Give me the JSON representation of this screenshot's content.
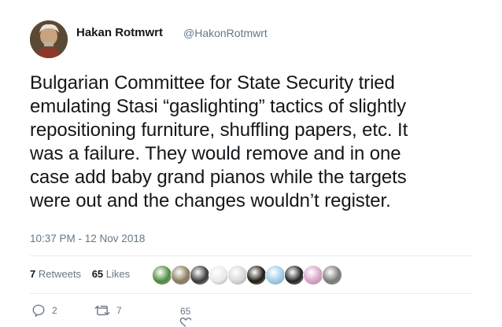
{
  "author": {
    "name": "Hakan Rotmwrt",
    "handle": "@HakonRotmwrt"
  },
  "tweet": {
    "lines": [
      "Bulgarian Committee for State Security tried",
      "emulating Stasi “gaslighting” tactics of slightly",
      "repositioning furniture, shuffling papers, etc. It",
      "was a failure. They would remove and in one",
      "case add baby grand pianos while the targets",
      "were out and the changes wouldn’t register."
    ],
    "timestamp": "10:37 PM - 12 Nov 2018"
  },
  "stats": {
    "retweets_count": "7",
    "retweets_label": "Retweets",
    "likes_count": "65",
    "likes_label": "Likes"
  },
  "liker_avatars": [
    {
      "name": "liker-avatar-1",
      "color": "#4e8a3a"
    },
    {
      "name": "liker-avatar-2",
      "color": "#8a7a5c"
    },
    {
      "name": "liker-avatar-3",
      "color": "#3a3a3a"
    },
    {
      "name": "liker-avatar-4",
      "color": "#e8e8e8"
    },
    {
      "name": "liker-avatar-5",
      "color": "#d7d7d7"
    },
    {
      "name": "liker-avatar-6",
      "color": "#1f1a10"
    },
    {
      "name": "liker-avatar-7",
      "color": "#9ccbe8"
    },
    {
      "name": "liker-avatar-8",
      "color": "#222222"
    },
    {
      "name": "liker-avatar-9",
      "color": "#d8a0c8"
    },
    {
      "name": "liker-avatar-10",
      "color": "#7a7a7a"
    }
  ],
  "actions": {
    "reply_count": "2",
    "retweet_count": "7",
    "like_count": "65"
  },
  "colors": {
    "text": "#14171a",
    "secondary": "#657786",
    "divider": "#e6ecf0"
  }
}
